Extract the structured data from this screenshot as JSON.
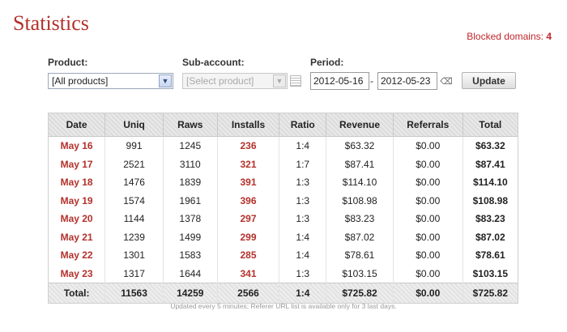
{
  "page": {
    "title": "Statistics"
  },
  "blocked": {
    "label": "Blocked domains:",
    "count": "4"
  },
  "filters": {
    "product_label": "Product:",
    "product_value": "[All products]",
    "subaccount_label": "Sub-account:",
    "subaccount_value": "[Select product]",
    "period_label": "Period:",
    "date_from": "2012-05-16",
    "date_separator": "-",
    "date_to": "2012-05-23",
    "update_label": "Update"
  },
  "table": {
    "headers": [
      "Date",
      "Uniq",
      "Raws",
      "Installs",
      "Ratio",
      "Revenue",
      "Referrals",
      "Total"
    ],
    "rows": [
      [
        "May 16",
        "991",
        "1245",
        "236",
        "1:4",
        "$63.32",
        "$0.00",
        "$63.32"
      ],
      [
        "May 17",
        "2521",
        "3110",
        "321",
        "1:7",
        "$87.41",
        "$0.00",
        "$87.41"
      ],
      [
        "May 18",
        "1476",
        "1839",
        "391",
        "1:3",
        "$114.10",
        "$0.00",
        "$114.10"
      ],
      [
        "May 19",
        "1574",
        "1961",
        "396",
        "1:3",
        "$108.98",
        "$0.00",
        "$108.98"
      ],
      [
        "May 20",
        "1144",
        "1378",
        "297",
        "1:3",
        "$83.23",
        "$0.00",
        "$83.23"
      ],
      [
        "May 21",
        "1239",
        "1499",
        "299",
        "1:4",
        "$87.02",
        "$0.00",
        "$87.02"
      ],
      [
        "May 22",
        "1301",
        "1583",
        "285",
        "1:4",
        "$78.61",
        "$0.00",
        "$78.61"
      ],
      [
        "May 23",
        "1317",
        "1644",
        "341",
        "1:3",
        "$103.15",
        "$0.00",
        "$103.15"
      ]
    ],
    "totals": [
      "Total:",
      "11563",
      "14259",
      "2566",
      "1:4",
      "$725.82",
      "$0.00",
      "$725.82"
    ]
  },
  "footnote": "Updated every 5 minutes; Referer URL list is available only for 3 last days.",
  "colors": {
    "accent": "#b3312c"
  }
}
